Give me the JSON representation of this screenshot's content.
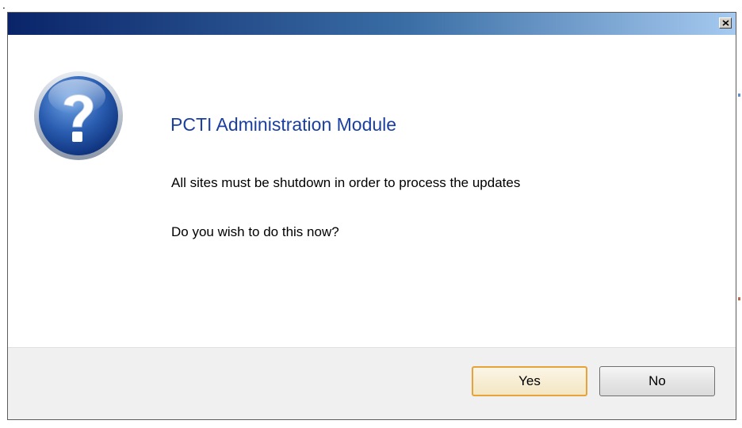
{
  "dialog": {
    "heading": "PCTI Administration Module",
    "message_line1": "All sites must be shutdown in order to process the updates",
    "message_line2": "Do you wish to do this now?",
    "icon": "question-icon",
    "close_icon": "close-icon"
  },
  "buttons": {
    "yes_label": "Yes",
    "no_label": "No"
  },
  "colors": {
    "titlebar_start": "#0a246a",
    "titlebar_end": "#a6caf0",
    "heading": "#1a3fa0",
    "default_button_border": "#e8a23a"
  },
  "stray_text": "."
}
